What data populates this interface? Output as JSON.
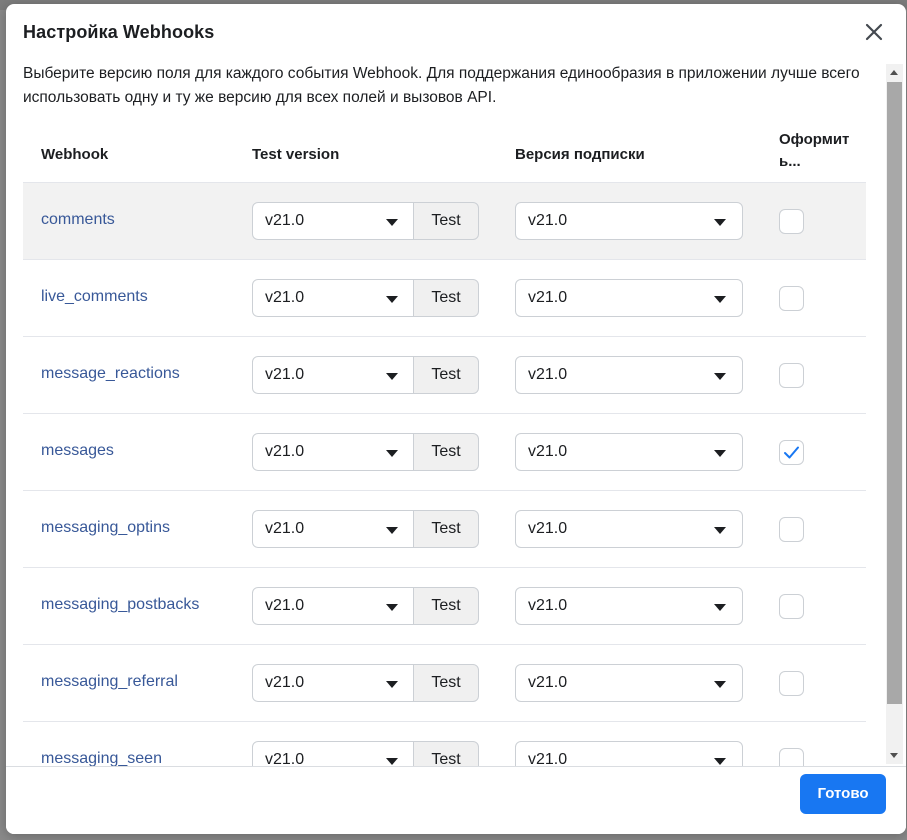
{
  "dialog": {
    "title": "Настройка Webhooks",
    "description": "Выберите версию поля для каждого события Webhook. Для поддержания единообразия в приложении лучше всего использовать одну и ту же версию для всех полей и вызовов API.",
    "close_icon": "close-icon"
  },
  "table": {
    "headers": {
      "webhook": "Webhook",
      "test_version": "Test version",
      "subscription_version": "Версия подписки",
      "format": "Оформит ь..."
    },
    "test_button_label": "Test",
    "rows": [
      {
        "name": "comments",
        "test_version": "v21.0",
        "subscription_version": "v21.0",
        "checked": false,
        "highlighted": true
      },
      {
        "name": "live_comments",
        "test_version": "v21.0",
        "subscription_version": "v21.0",
        "checked": false,
        "highlighted": false
      },
      {
        "name": "message_reactions",
        "test_version": "v21.0",
        "subscription_version": "v21.0",
        "checked": false,
        "highlighted": false
      },
      {
        "name": "messages",
        "test_version": "v21.0",
        "subscription_version": "v21.0",
        "checked": true,
        "highlighted": false
      },
      {
        "name": "messaging_optins",
        "test_version": "v21.0",
        "subscription_version": "v21.0",
        "checked": false,
        "highlighted": false
      },
      {
        "name": "messaging_postbacks",
        "test_version": "v21.0",
        "subscription_version": "v21.0",
        "checked": false,
        "highlighted": false
      },
      {
        "name": "messaging_referral",
        "test_version": "v21.0",
        "subscription_version": "v21.0",
        "checked": false,
        "highlighted": false
      },
      {
        "name": "messaging_seen",
        "test_version": "v21.0",
        "subscription_version": "v21.0",
        "checked": false,
        "highlighted": false
      }
    ]
  },
  "footer": {
    "done_label": "Готово"
  },
  "colors": {
    "link": "#385898",
    "primary_button": "#1877f2",
    "check": "#1877f2",
    "row_highlight": "#f2f2f2"
  }
}
